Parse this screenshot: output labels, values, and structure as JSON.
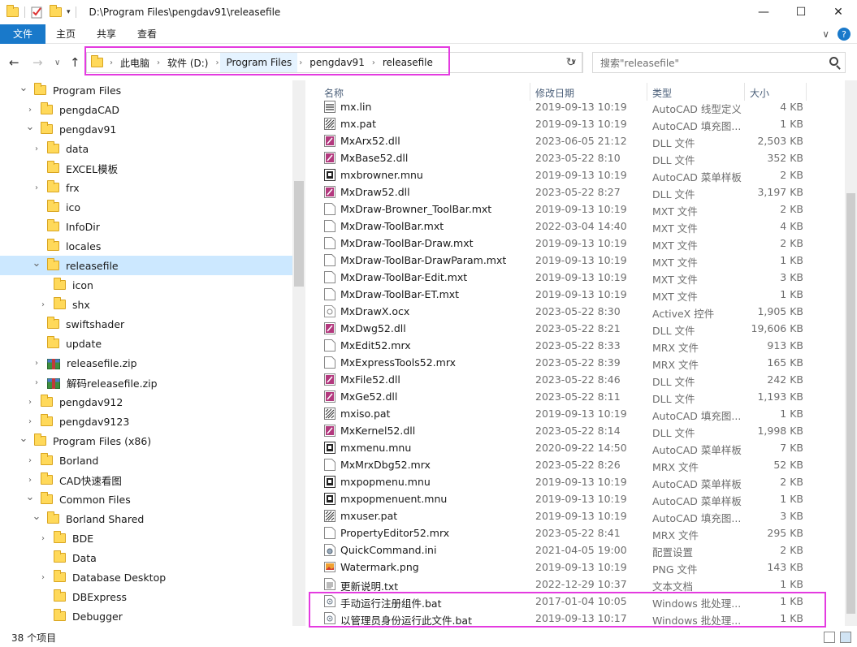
{
  "window": {
    "title": "D:\\Program Files\\pengdav91\\releasefile",
    "min_glyph": "—",
    "max_glyph": "☐",
    "close_glyph": "✕"
  },
  "ribbon": {
    "tabs": [
      "文件",
      "主页",
      "共享",
      "查看"
    ],
    "expand_glyph": "∨",
    "help_glyph": "?"
  },
  "nav": {
    "back_glyph": "←",
    "forward_glyph": "→",
    "recent_glyph": "∨",
    "up_glyph": "↑"
  },
  "address": {
    "crumbs": [
      "此电脑",
      "软件 (D:)",
      "Program Files",
      "pengdav91",
      "releasefile"
    ],
    "sep": "›",
    "dropdown_glyph": "∨",
    "refresh_glyph": "↻"
  },
  "search": {
    "placeholder": "搜索\"releasefile\""
  },
  "tree": [
    {
      "label": "Program Files",
      "indent": 0,
      "expanded": true,
      "chevron": true,
      "icon": "folder"
    },
    {
      "label": "pengdaCAD",
      "indent": 1,
      "expanded": false,
      "chevron": true,
      "icon": "folder"
    },
    {
      "label": "pengdav91",
      "indent": 1,
      "expanded": true,
      "chevron": true,
      "icon": "folder"
    },
    {
      "label": "data",
      "indent": 2,
      "expanded": false,
      "chevron": true,
      "icon": "folder"
    },
    {
      "label": "EXCEL模板",
      "indent": 2,
      "chevron": false,
      "icon": "folder"
    },
    {
      "label": "frx",
      "indent": 2,
      "expanded": false,
      "chevron": true,
      "icon": "folder"
    },
    {
      "label": "ico",
      "indent": 2,
      "chevron": false,
      "icon": "folder"
    },
    {
      "label": "InfoDir",
      "indent": 2,
      "chevron": false,
      "icon": "folder"
    },
    {
      "label": "locales",
      "indent": 2,
      "chevron": false,
      "icon": "folder"
    },
    {
      "label": "releasefile",
      "indent": 2,
      "expanded": true,
      "chevron": true,
      "icon": "folder",
      "selected": true
    },
    {
      "label": "icon",
      "indent": 3,
      "chevron": false,
      "icon": "folder"
    },
    {
      "label": "shx",
      "indent": 3,
      "expanded": false,
      "chevron": true,
      "icon": "folder"
    },
    {
      "label": "swiftshader",
      "indent": 2,
      "chevron": false,
      "icon": "folder"
    },
    {
      "label": "update",
      "indent": 2,
      "chevron": false,
      "icon": "folder"
    },
    {
      "label": "releasefile.zip",
      "indent": 2,
      "expanded": false,
      "chevron": true,
      "icon": "zip"
    },
    {
      "label": "解码releasefile.zip",
      "indent": 2,
      "expanded": false,
      "chevron": true,
      "icon": "zip"
    },
    {
      "label": "pengdav912",
      "indent": 1,
      "expanded": false,
      "chevron": true,
      "icon": "folder"
    },
    {
      "label": "pengdav9123",
      "indent": 1,
      "expanded": false,
      "chevron": true,
      "icon": "folder"
    },
    {
      "label": "Program Files (x86)",
      "indent": 0,
      "expanded": true,
      "chevron": true,
      "icon": "folder"
    },
    {
      "label": "Borland",
      "indent": 1,
      "expanded": false,
      "chevron": true,
      "icon": "folder"
    },
    {
      "label": "CAD快速看图",
      "indent": 1,
      "expanded": false,
      "chevron": true,
      "icon": "folder"
    },
    {
      "label": "Common Files",
      "indent": 1,
      "expanded": true,
      "chevron": true,
      "icon": "folder"
    },
    {
      "label": "Borland Shared",
      "indent": 2,
      "expanded": true,
      "chevron": true,
      "icon": "folder"
    },
    {
      "label": "BDE",
      "indent": 3,
      "expanded": false,
      "chevron": true,
      "icon": "folder"
    },
    {
      "label": "Data",
      "indent": 3,
      "chevron": false,
      "icon": "folder"
    },
    {
      "label": "Database Desktop",
      "indent": 3,
      "expanded": false,
      "chevron": true,
      "icon": "folder"
    },
    {
      "label": "DBExpress",
      "indent": 3,
      "chevron": false,
      "icon": "folder"
    },
    {
      "label": "Debugger",
      "indent": 3,
      "chevron": false,
      "icon": "folder"
    }
  ],
  "columns": {
    "name": "名称",
    "date": "修改日期",
    "type": "类型",
    "size": "大小"
  },
  "files": [
    {
      "name": "mx.lin",
      "date": "2019-09-13 10:19",
      "type": "AutoCAD 线型定义",
      "size": "4 KB",
      "icon": "lin"
    },
    {
      "name": "mx.pat",
      "date": "2019-09-13 10:19",
      "type": "AutoCAD 填充图...",
      "size": "1 KB",
      "icon": "pat"
    },
    {
      "name": "MxArx52.dll",
      "date": "2023-06-05 21:12",
      "type": "DLL 文件",
      "size": "2,503 KB",
      "icon": "dll"
    },
    {
      "name": "MxBase52.dll",
      "date": "2023-05-22 8:10",
      "type": "DLL 文件",
      "size": "352 KB",
      "icon": "dll"
    },
    {
      "name": "mxbrowner.mnu",
      "date": "2019-09-13 10:19",
      "type": "AutoCAD 菜单样板",
      "size": "2 KB",
      "icon": "mnu"
    },
    {
      "name": "MxDraw52.dll",
      "date": "2023-05-22 8:27",
      "type": "DLL 文件",
      "size": "3,197 KB",
      "icon": "dll"
    },
    {
      "name": "MxDraw-Browner_ToolBar.mxt",
      "date": "2019-09-13 10:19",
      "type": "MXT 文件",
      "size": "2 KB",
      "icon": "blank"
    },
    {
      "name": "MxDraw-ToolBar.mxt",
      "date": "2022-03-04 14:40",
      "type": "MXT 文件",
      "size": "4 KB",
      "icon": "blank"
    },
    {
      "name": "MxDraw-ToolBar-Draw.mxt",
      "date": "2019-09-13 10:19",
      "type": "MXT 文件",
      "size": "2 KB",
      "icon": "blank"
    },
    {
      "name": "MxDraw-ToolBar-DrawParam.mxt",
      "date": "2019-09-13 10:19",
      "type": "MXT 文件",
      "size": "1 KB",
      "icon": "blank"
    },
    {
      "name": "MxDraw-ToolBar-Edit.mxt",
      "date": "2019-09-13 10:19",
      "type": "MXT 文件",
      "size": "3 KB",
      "icon": "blank"
    },
    {
      "name": "MxDraw-ToolBar-ET.mxt",
      "date": "2019-09-13 10:19",
      "type": "MXT 文件",
      "size": "1 KB",
      "icon": "blank"
    },
    {
      "name": "MxDrawX.ocx",
      "date": "2023-05-22 8:30",
      "type": "ActiveX 控件",
      "size": "1,905 KB",
      "icon": "ocx"
    },
    {
      "name": "MxDwg52.dll",
      "date": "2023-05-22 8:21",
      "type": "DLL 文件",
      "size": "19,606 KB",
      "icon": "dll"
    },
    {
      "name": "MxEdit52.mrx",
      "date": "2023-05-22 8:33",
      "type": "MRX 文件",
      "size": "913 KB",
      "icon": "blank"
    },
    {
      "name": "MxExpressTools52.mrx",
      "date": "2023-05-22 8:39",
      "type": "MRX 文件",
      "size": "165 KB",
      "icon": "blank"
    },
    {
      "name": "MxFile52.dll",
      "date": "2023-05-22 8:46",
      "type": "DLL 文件",
      "size": "242 KB",
      "icon": "dll"
    },
    {
      "name": "MxGe52.dll",
      "date": "2023-05-22 8:11",
      "type": "DLL 文件",
      "size": "1,193 KB",
      "icon": "dll"
    },
    {
      "name": "mxiso.pat",
      "date": "2019-09-13 10:19",
      "type": "AutoCAD 填充图...",
      "size": "1 KB",
      "icon": "pat"
    },
    {
      "name": "MxKernel52.dll",
      "date": "2023-05-22 8:14",
      "type": "DLL 文件",
      "size": "1,998 KB",
      "icon": "dll"
    },
    {
      "name": "mxmenu.mnu",
      "date": "2020-09-22 14:50",
      "type": "AutoCAD 菜单样板",
      "size": "7 KB",
      "icon": "mnu"
    },
    {
      "name": "MxMrxDbg52.mrx",
      "date": "2023-05-22 8:26",
      "type": "MRX 文件",
      "size": "52 KB",
      "icon": "blank"
    },
    {
      "name": "mxpopmenu.mnu",
      "date": "2019-09-13 10:19",
      "type": "AutoCAD 菜单样板",
      "size": "2 KB",
      "icon": "mnu"
    },
    {
      "name": "mxpopmenuent.mnu",
      "date": "2019-09-13 10:19",
      "type": "AutoCAD 菜单样板",
      "size": "1 KB",
      "icon": "mnu"
    },
    {
      "name": "mxuser.pat",
      "date": "2019-09-13 10:19",
      "type": "AutoCAD 填充图...",
      "size": "3 KB",
      "icon": "pat"
    },
    {
      "name": "PropertyEditor52.mrx",
      "date": "2023-05-22 8:41",
      "type": "MRX 文件",
      "size": "295 KB",
      "icon": "blank"
    },
    {
      "name": "QuickCommand.ini",
      "date": "2021-04-05 19:00",
      "type": "配置设置",
      "size": "2 KB",
      "icon": "ini"
    },
    {
      "name": "Watermark.png",
      "date": "2019-09-13 10:19",
      "type": "PNG 文件",
      "size": "143 KB",
      "icon": "png"
    },
    {
      "name": "更新说明.txt",
      "date": "2022-12-29 10:37",
      "type": "文本文档",
      "size": "1 KB",
      "icon": "txt"
    },
    {
      "name": "手动运行注册组件.bat",
      "date": "2017-01-04 10:05",
      "type": "Windows 批处理...",
      "size": "1 KB",
      "icon": "bat"
    },
    {
      "name": "以管理员身份运行此文件.bat",
      "date": "2019-09-13 10:17",
      "type": "Windows 批处理...",
      "size": "1 KB",
      "icon": "bat"
    }
  ],
  "status": {
    "count": "38 个项目"
  },
  "colors": {
    "accent": "#1979ca",
    "highlight": "#e43be0",
    "selected": "#cce8ff",
    "folder": "#ffd95a"
  }
}
